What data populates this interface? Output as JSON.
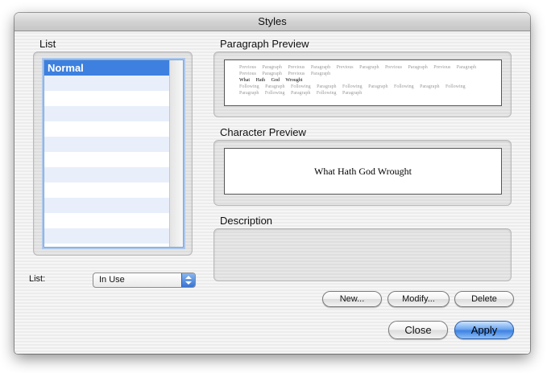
{
  "window": {
    "title": "Styles"
  },
  "list_section": {
    "label": "List",
    "items": [
      {
        "label": "Normal",
        "selected": true
      },
      {
        "label": "",
        "selected": false
      },
      {
        "label": "",
        "selected": false
      },
      {
        "label": "",
        "selected": false
      },
      {
        "label": "",
        "selected": false
      },
      {
        "label": "",
        "selected": false
      },
      {
        "label": "",
        "selected": false
      },
      {
        "label": "",
        "selected": false
      },
      {
        "label": "",
        "selected": false
      },
      {
        "label": "",
        "selected": false
      },
      {
        "label": "",
        "selected": false
      },
      {
        "label": "",
        "selected": false
      }
    ]
  },
  "paragraph_preview": {
    "label": "Paragraph Preview",
    "previous_line_1": "Previous Paragraph Previous Paragraph Previous Paragraph Previous Paragraph Previous Paragraph",
    "previous_line_2": "Previous Paragraph Previous Paragraph",
    "current_line": "What Hath God Wrought",
    "following_line_1": "Following Paragraph Following Paragraph Following Paragraph Following Paragraph Following",
    "following_line_2": "Paragraph Following Paragraph Following Paragraph"
  },
  "character_preview": {
    "label": "Character Preview",
    "text": "What Hath God Wrought"
  },
  "description": {
    "label": "Description",
    "text": ""
  },
  "list_filter": {
    "label": "List:",
    "value": "In Use"
  },
  "buttons": {
    "new": "New...",
    "modify": "Modify...",
    "delete": "Delete",
    "close": "Close",
    "apply": "Apply"
  },
  "colors": {
    "selection": "#3d80df",
    "default_button": "#3e82e3",
    "stripe": "#e8effb"
  }
}
